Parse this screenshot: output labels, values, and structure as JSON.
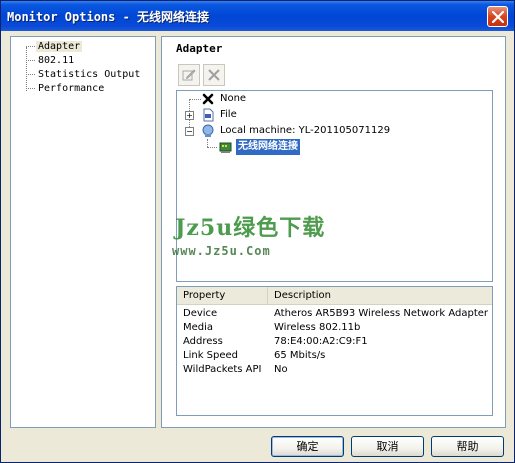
{
  "window": {
    "title": "Monitor Options - 无线网络连接"
  },
  "nav": {
    "items": [
      {
        "label": "Adapter",
        "selected": true
      },
      {
        "label": "802.11",
        "selected": false
      },
      {
        "label": "Statistics Output",
        "selected": false
      },
      {
        "label": "Performance",
        "selected": false
      }
    ]
  },
  "main": {
    "title": "Adapter",
    "toolbar": {
      "edit_icon": "edit-icon",
      "delete_icon": "delete-icon"
    },
    "tree": {
      "none_label": "None",
      "file_label": "File",
      "local_label": "Local machine: YL-201105071129",
      "adapter_label": "无线网络连接"
    },
    "properties": {
      "columns": [
        "Property",
        "Description"
      ],
      "rows": [
        {
          "property": "Device",
          "description": "Atheros AR5B93 Wireless Network Adapter"
        },
        {
          "property": "Media",
          "description": "Wireless 802.11b"
        },
        {
          "property": "Address",
          "description": "78:E4:00:A2:C9:F1"
        },
        {
          "property": "Link Speed",
          "description": "65 Mbits/s"
        },
        {
          "property": "WildPackets API",
          "description": "No"
        }
      ]
    }
  },
  "watermark": {
    "line1": "Jz5u绿色下载",
    "line2": "www.Jz5u.Com"
  },
  "buttons": {
    "ok": "确定",
    "cancel": "取消",
    "help": "帮助"
  },
  "colors": {
    "titlebar": "#0046d5",
    "selection": "#316ac5",
    "watermark": "#2e8a2e"
  }
}
